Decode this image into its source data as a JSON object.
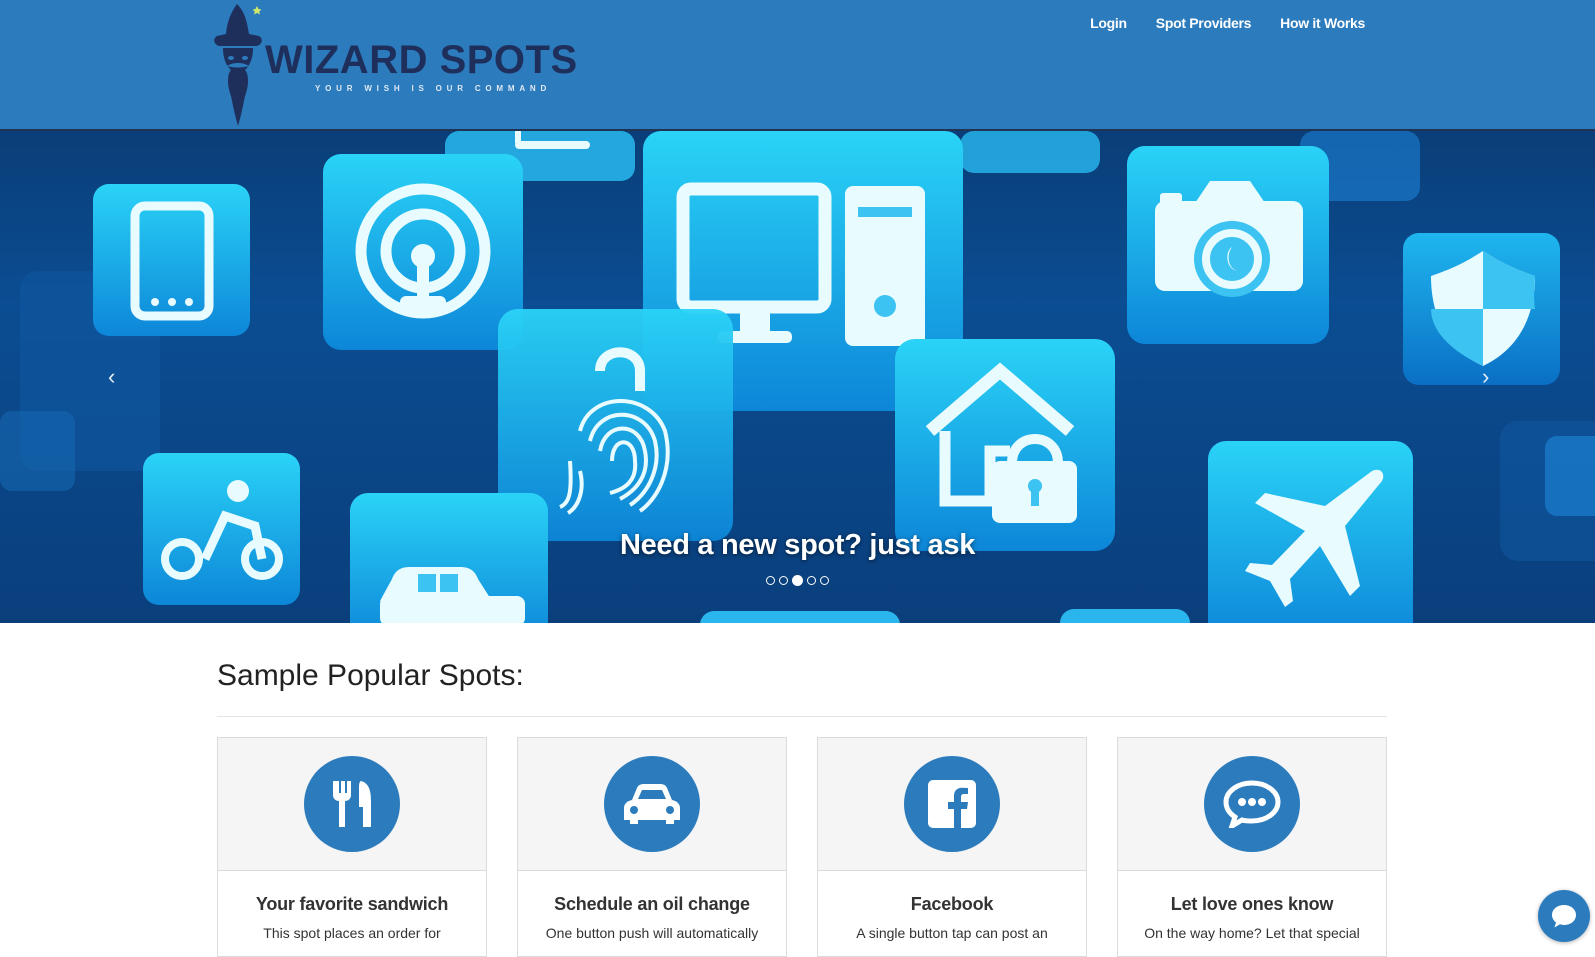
{
  "header": {
    "logo_text": "WIZARD SPOTS",
    "logo_tagline": "YOUR WISH IS OUR COMMAND",
    "nav": [
      "Login",
      "Spot Providers",
      "How it Works"
    ]
  },
  "hero": {
    "caption": "Need a new spot? just ask",
    "slide_count": 5,
    "active_slide": 3,
    "prev_label": "‹",
    "next_label": "›"
  },
  "section": {
    "title": "Sample Popular Spots:"
  },
  "cards": [
    {
      "icon": "utensils-icon",
      "title": "Your favorite sandwich",
      "text": "This spot places an order for"
    },
    {
      "icon": "car-icon",
      "title": "Schedule an oil change",
      "text": "One button push will automatically"
    },
    {
      "icon": "facebook-icon",
      "title": "Facebook",
      "text": "A single button tap can post an"
    },
    {
      "icon": "chat-bubble-icon",
      "title": "Let love ones know",
      "text": "On the way home? Let that special"
    }
  ],
  "colors": {
    "brand_blue": "#2b7bbd",
    "logo_navy": "#1f2f5c"
  }
}
